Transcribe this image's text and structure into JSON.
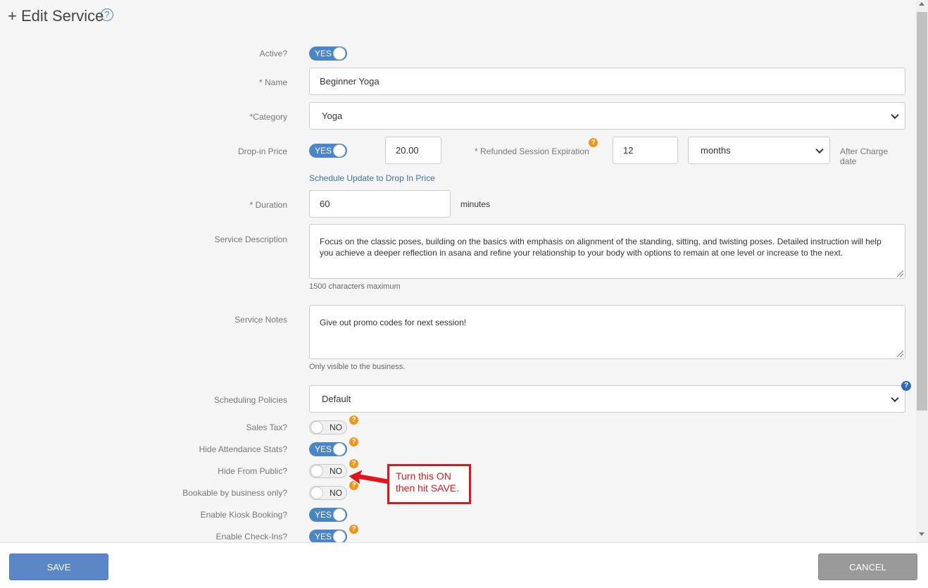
{
  "header": {
    "title": "+ Edit Service",
    "help_icon": "?"
  },
  "fields": {
    "active": {
      "label": "Active?",
      "state": "YES"
    },
    "name": {
      "label": "* Name",
      "value": "Beginner Yoga"
    },
    "category": {
      "label": "*Category",
      "value": "Yoga"
    },
    "dropin": {
      "label": "Drop-in Price",
      "state": "YES",
      "price": "20.00",
      "schedule_link": "Schedule Update to Drop In Price"
    },
    "refund": {
      "label": "* Refunded Session Expiration",
      "value": "12",
      "unit": "months",
      "after_line1": "After Charge",
      "after_line2": "date"
    },
    "duration": {
      "label": "* Duration",
      "value": "60",
      "unit": "minutes"
    },
    "description": {
      "label": "Service Description",
      "value": "Focus on the classic poses, building on the basics with emphasis on alignment of the standing, sitting, and twisting poses. Detailed instruction will help you achieve a deeper reflection in asana and refine your relationship to your body with options to remain at one level or increase to the next.",
      "hint": "1500 characters maximum"
    },
    "notes": {
      "label": "Service Notes",
      "value": "Give out promo codes for next session!",
      "hint": "Only visible to the business."
    },
    "scheduling": {
      "label": "Scheduling Policies",
      "value": "Default"
    },
    "sales_tax": {
      "label": "Sales Tax?",
      "state": "NO"
    },
    "hide_attendance": {
      "label": "Hide Attendance Stats?",
      "state": "YES"
    },
    "hide_public": {
      "label": "Hide From Public?",
      "state": "NO"
    },
    "bookable_business": {
      "label": "Bookable by business only?",
      "state": "NO"
    },
    "kiosk": {
      "label": "Enable Kiosk Booking?",
      "state": "YES"
    },
    "checkins": {
      "label": "Enable Check-Ins?",
      "state": "YES"
    }
  },
  "callout": {
    "line1": "Turn this ON",
    "line2": "then hit SAVE."
  },
  "footer": {
    "save_label": "SAVE",
    "cancel_label": "CANCEL"
  },
  "colors": {
    "accent": "#4a86c5",
    "callout": "#e3151b",
    "help_orange": "#f0961a"
  }
}
